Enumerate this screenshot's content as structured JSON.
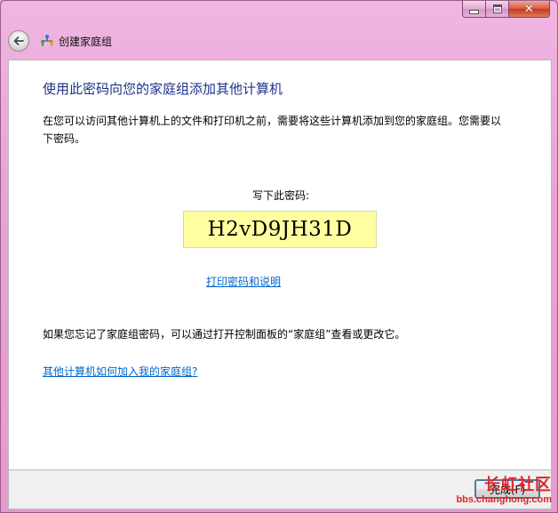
{
  "window": {
    "title": "创建家庭组",
    "caption": {
      "minimize": "—",
      "maximize": "□",
      "close": "✕"
    }
  },
  "content": {
    "heading": "使用此密码向您的家庭组添加其他计算机",
    "description": "在您可以访问其他计算机上的文件和打印机之前，需要将这些计算机添加到您的家庭组。您需要以下密码。",
    "password_label": "写下此密码:",
    "password": "H2vD9JH31D",
    "print_link": "打印密码和说明",
    "forgot_text": "如果您忘记了家庭组密码，可以通过打开控制面板的“家庭组”查看或更改它。",
    "how_link": "其他计算机如何加入我的家庭组?"
  },
  "footer": {
    "next_button": "完成(F)"
  },
  "watermark": {
    "title": "长虹社区",
    "url": "bbs.changhong.com"
  },
  "icons": {
    "back": "back-arrow-icon",
    "homegroup": "homegroup-icon"
  },
  "colors": {
    "frame": "#e59ad0",
    "heading": "#1e3287",
    "link": "#0066cc",
    "password_bg": "#ffffa0",
    "watermark": "#e3232a"
  }
}
